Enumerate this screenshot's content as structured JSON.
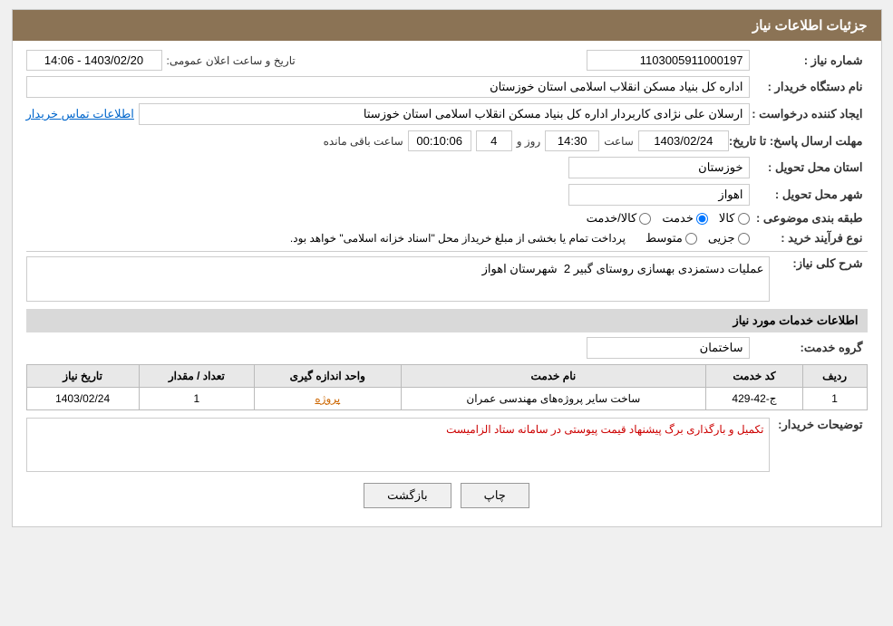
{
  "header": {
    "title": "جزئیات اطلاعات نیاز"
  },
  "fields": {
    "need_number_label": "شماره نیاز :",
    "need_number_value": "1103005911000197",
    "buyer_org_label": "نام دستگاه خریدار :",
    "buyer_org_value": "اداره کل بنیاد مسکن انقلاب اسلامی استان خوزستان",
    "creator_label": "ایجاد کننده درخواست :",
    "creator_value": "ارسلان علی نژادی کاربردار اداره کل بنیاد مسکن انقلاب اسلامی استان خوزستا",
    "creator_link": "اطلاعات تماس خریدار",
    "response_date_label": "مهلت ارسال پاسخ: تا تاریخ:",
    "date_value": "1403/02/24",
    "time_label": "ساعت",
    "time_value": "14:30",
    "days_label": "روز و",
    "days_value": "4",
    "remaining_label": "ساعت باقی مانده",
    "remaining_value": "00:10:06",
    "province_label": "استان محل تحویل :",
    "province_value": "خوزستان",
    "city_label": "شهر محل تحویل :",
    "city_value": "اهواز",
    "category_label": "طبقه بندی موضوعی :",
    "category_options": [
      "کالا",
      "خدمت",
      "کالا/خدمت"
    ],
    "category_selected": "خدمت",
    "process_label": "نوع فرآیند خرید :",
    "process_options": [
      "جزیی",
      "متوسط"
    ],
    "process_note": "پرداخت تمام یا بخشی از مبلغ خریداز محل \"اسناد خزانه اسلامی\" خواهد بود.",
    "announcement_label": "تاریخ و ساعت اعلان عمومی:",
    "announcement_value": "1403/02/20 - 14:06",
    "description_title": "شرح کلی نیاز:",
    "description_value": "عملیات دستمزدی بهسازی روستای گبیر 2  شهرستان اهواز",
    "services_title": "اطلاعات خدمات مورد نیاز",
    "service_group_label": "گروه خدمت:",
    "service_group_value": "ساختمان",
    "table": {
      "columns": [
        "ردیف",
        "کد خدمت",
        "نام خدمت",
        "واحد اندازه گیری",
        "تعداد / مقدار",
        "تاریخ نیاز"
      ],
      "rows": [
        {
          "row": "1",
          "code": "ج-42-429",
          "name": "ساخت سایر پروژه‌های مهندسی عمران",
          "unit": "پروژه",
          "count": "1",
          "date": "1403/02/24"
        }
      ]
    },
    "buyer_notes_label": "توضیحات خریدار:",
    "buyer_notes_value": "تکمیل و بارگذاری برگ پیشنهاد قیمت پیوستی در سامانه ستاد الزامیست"
  },
  "buttons": {
    "print_label": "چاپ",
    "back_label": "بازگشت"
  }
}
